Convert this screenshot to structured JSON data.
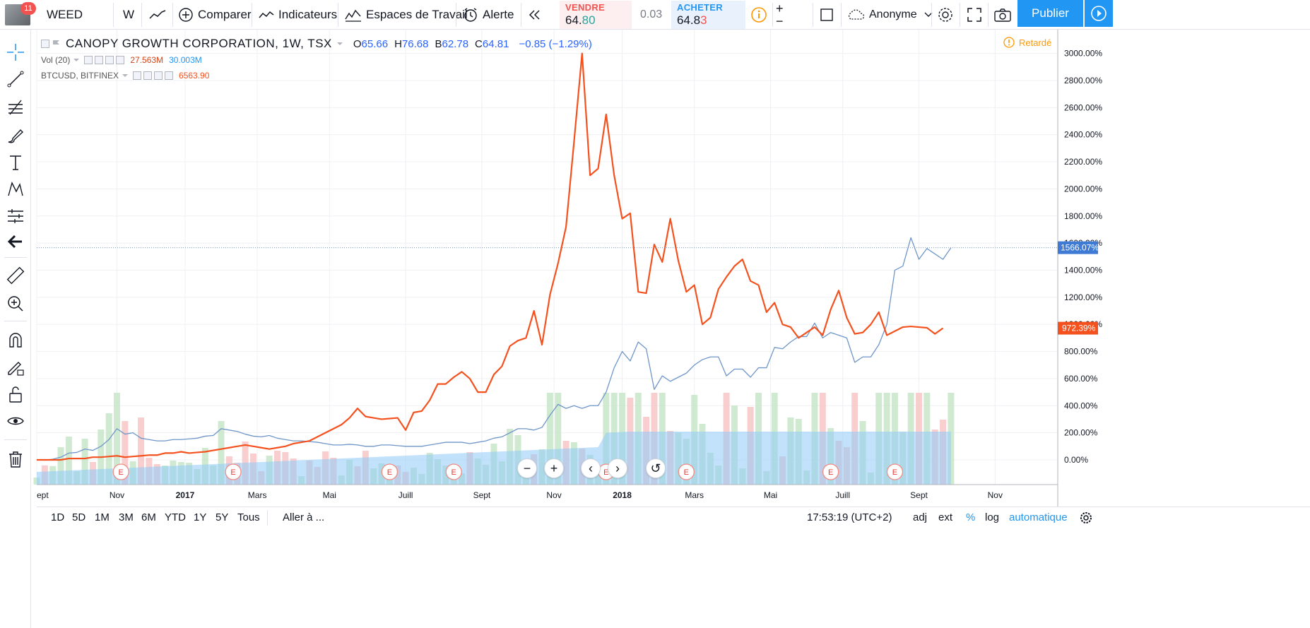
{
  "toolbar": {
    "notification_count": "11",
    "symbol": "WEED",
    "interval": "W",
    "compare_label": "Comparer",
    "indicators_label": "Indicateurs",
    "workspaces_label": "Espaces de Travail",
    "alert_label": "Alerte",
    "sell_label": "VENDRE",
    "sell_price_main": "64.",
    "sell_price_emph": "80",
    "spread": "0.03",
    "buy_label": "ACHETER",
    "buy_price_main": "64.8",
    "buy_price_emph": "3",
    "user_label": "Anonyme",
    "publish_label": "Publier"
  },
  "legend": {
    "title": "CANOPY GROWTH CORPORATION, 1W, TSX",
    "o_label": "O",
    "o_value": "65.66",
    "h_label": "H",
    "h_value": "76.68",
    "b_label": "B",
    "b_value": "62.78",
    "c_label": "C",
    "c_value": "64.81",
    "change": "−0.85 (−1.29%)",
    "vol_label": "Vol (20)",
    "vol_value1": "27.563M",
    "vol_value2": "30.003M",
    "btc_label": "BTCUSD, BITFINEX",
    "btc_value": "6563.90",
    "delayed_label": "Retardé"
  },
  "bottom": {
    "ranges": [
      "1D",
      "5D",
      "1M",
      "3M",
      "6M",
      "YTD",
      "1Y",
      "5Y",
      "Tous"
    ],
    "goto_label": "Aller à ...",
    "time": "17:53:19 (UTC+2)",
    "adj": "adj",
    "ext": "ext",
    "pct": "%",
    "log": "log",
    "auto": "automatique"
  },
  "colors": {
    "weed_line": "#6f96c9",
    "btc_line": "#f4511e",
    "vol_up": "#c8e6c9",
    "vol_down": "#f7c6c6",
    "vol_ma": "#90caf9",
    "accent": "#2196f3",
    "sell": "#f05350",
    "buy": "#2196f3"
  },
  "chart_data": {
    "type": "line",
    "title": "CANOPY GROWTH CORPORATION, 1W, TSX",
    "y_unit": "%",
    "ylim": [
      -200,
      3100
    ],
    "y_ticks": [
      "3000.00%",
      "2800.00%",
      "2600.00%",
      "2400.00%",
      "2200.00%",
      "2000.00%",
      "1800.00%",
      "1600.00%",
      "1400.00%",
      "1200.00%",
      "1000.00%",
      "800.00%",
      "600.00%",
      "400.00%",
      "200.00%",
      "0.00%"
    ],
    "y_tick_values": [
      3000,
      2800,
      2600,
      2400,
      2200,
      2000,
      1800,
      1600,
      1400,
      1200,
      1000,
      800,
      600,
      400,
      200,
      0
    ],
    "x_labels": [
      "ept",
      "Nov",
      "2017",
      "Mars",
      "Mai",
      "Juill",
      "Sept",
      "Nov",
      "2018",
      "Mars",
      "Mai",
      "Juill",
      "Sept",
      "Nov"
    ],
    "x_label_weeks": [
      0,
      10,
      18.5,
      27.5,
      36.5,
      46,
      55.5,
      64.5,
      73,
      82,
      91.5,
      100.5,
      110,
      119.5
    ],
    "current_labels": {
      "weed": "1566.07%",
      "btc": "972.39%"
    },
    "earnings_marker": "E",
    "earnings_weeks": [
      10.5,
      24.5,
      44,
      52,
      71,
      81,
      99,
      107
    ],
    "series": [
      {
        "name": "WEED",
        "values": [
          0,
          -2,
          5,
          20,
          50,
          55,
          80,
          70,
          100,
          150,
          230,
          190,
          200,
          160,
          150,
          140,
          140,
          150,
          150,
          155,
          160,
          175,
          180,
          230,
          220,
          210,
          190,
          175,
          170,
          180,
          160,
          150,
          140,
          140,
          135,
          130,
          120,
          110,
          110,
          115,
          110,
          100,
          100,
          110,
          110,
          105,
          100,
          100,
          100,
          110,
          120,
          130,
          130,
          130,
          120,
          130,
          140,
          160,
          170,
          200,
          230,
          230,
          220,
          240,
          330,
          410,
          380,
          400,
          380,
          400,
          400,
          500,
          680,
          800,
          730,
          870,
          820,
          520,
          620,
          580,
          610,
          640,
          700,
          740,
          760,
          760,
          620,
          670,
          670,
          610,
          680,
          680,
          830,
          820,
          870,
          910,
          910,
          1010,
          900,
          940,
          920,
          900,
          720,
          760,
          760,
          850,
          1000,
          1400,
          1430,
          1640,
          1480,
          1560,
          1520,
          1480,
          1566
        ]
      },
      {
        "name": "BTCUSD",
        "values": [
          0,
          0,
          0,
          0,
          10,
          10,
          10,
          20,
          20,
          25,
          30,
          20,
          25,
          30,
          35,
          35,
          50,
          50,
          60,
          50,
          55,
          60,
          70,
          80,
          90,
          100,
          110,
          100,
          90,
          80,
          90,
          100,
          120,
          130,
          140,
          170,
          200,
          230,
          260,
          310,
          380,
          320,
          310,
          300,
          305,
          310,
          220,
          350,
          360,
          440,
          560,
          560,
          610,
          650,
          600,
          500,
          500,
          630,
          690,
          840,
          880,
          900,
          1100,
          850,
          1220,
          1450,
          1720,
          2350,
          3000,
          2100,
          2150,
          2550,
          2100,
          1780,
          1820,
          1240,
          1230,
          1590,
          1460,
          1780,
          1470,
          1240,
          1290,
          1000,
          1050,
          1260,
          1350,
          1430,
          1480,
          1320,
          1290,
          1090,
          1160,
          1000,
          980,
          900,
          940,
          980,
          920,
          1110,
          1250,
          1050,
          930,
          940,
          1000,
          1090,
          920,
          950,
          980,
          985,
          980,
          975,
          930,
          972
        ]
      }
    ]
  }
}
